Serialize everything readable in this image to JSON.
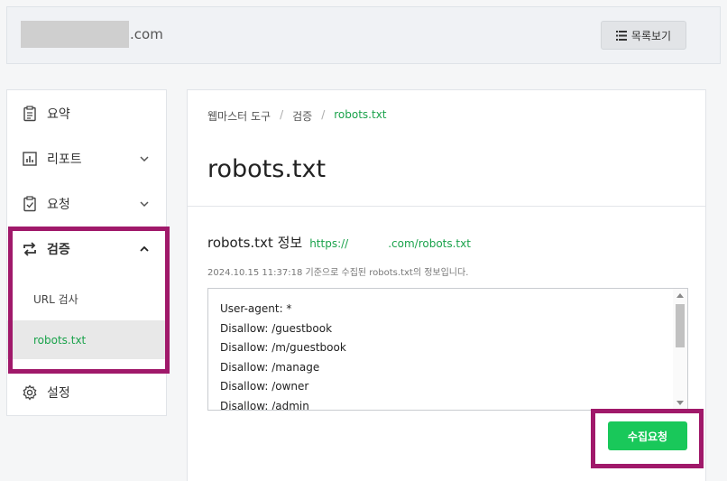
{
  "header": {
    "site_domain": ".com",
    "list_button_label": "목록보기"
  },
  "sidebar": {
    "items": [
      {
        "label": "요약"
      },
      {
        "label": "리포트"
      },
      {
        "label": "요청"
      },
      {
        "label": "검증"
      },
      {
        "label": "설정"
      }
    ],
    "sub_items": [
      {
        "label": "URL 검사"
      },
      {
        "label": "robots.txt"
      }
    ]
  },
  "breadcrumb": [
    "웹마스터 도구",
    "검증",
    "robots.txt"
  ],
  "page_title": "robots.txt",
  "info": {
    "title": "robots.txt 정보",
    "url_prefix": "https://",
    "url_suffix": ".com/robots.txt",
    "description": "2024.10.15 11:37:18 기준으로 수집된 robots.txt의 정보입니다."
  },
  "robots_lines": [
    "User-agent: *",
    "Disallow: /guestbook",
    "Disallow: /m/guestbook",
    "Disallow: /manage",
    "Disallow: /owner",
    "Disallow: /admin"
  ],
  "collect_button_label": "수집요청",
  "colors": {
    "accent_green": "#19c85a",
    "link_green": "#1aa24b",
    "highlight": "#a0196a"
  }
}
